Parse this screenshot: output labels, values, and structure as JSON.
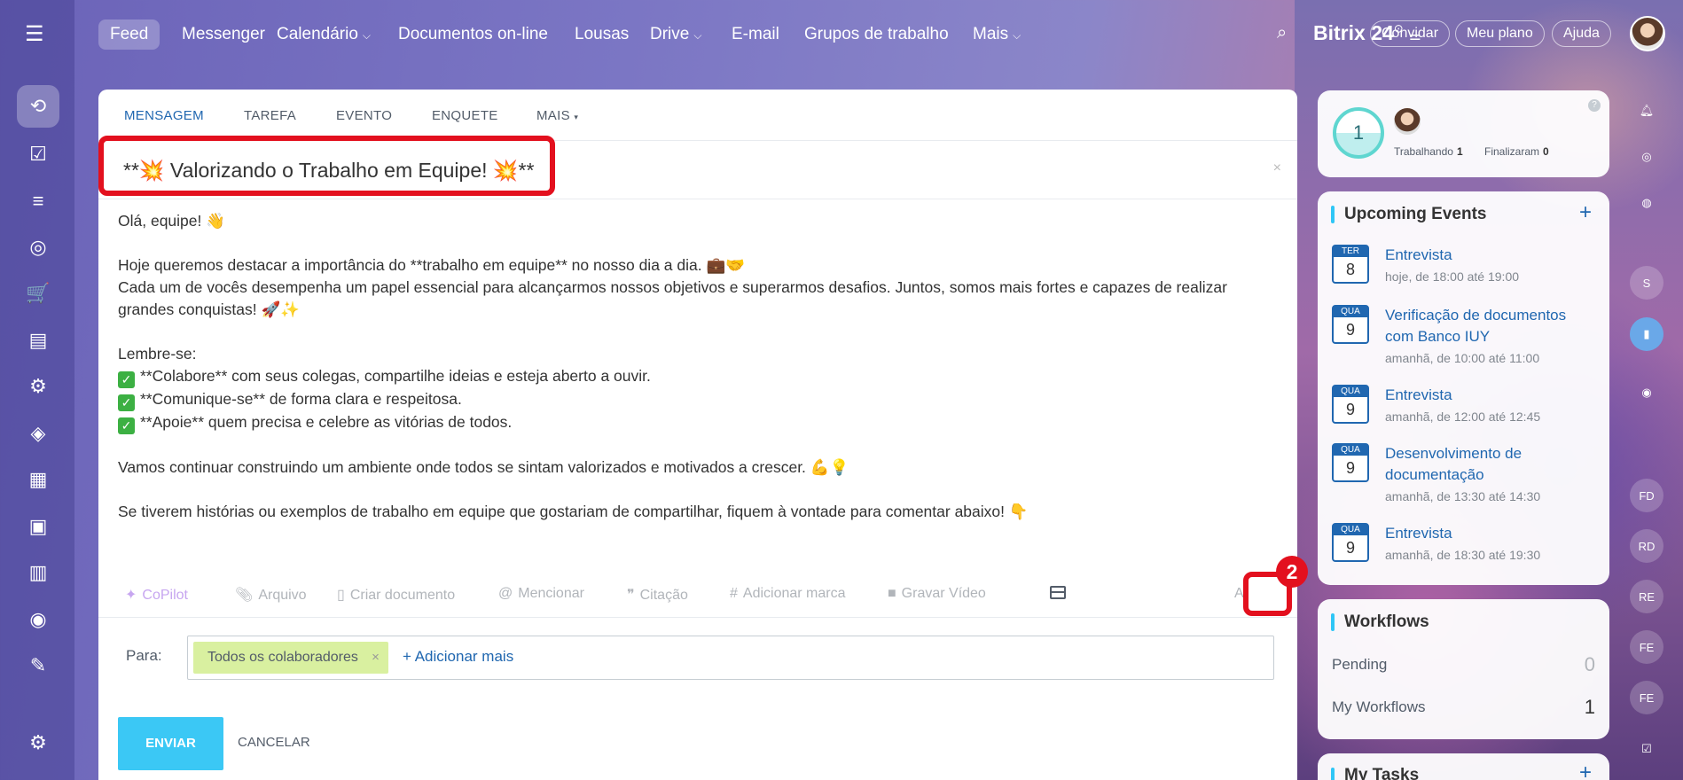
{
  "nav": {
    "items": [
      {
        "label": "Feed"
      },
      {
        "label": "Messenger"
      },
      {
        "label": "Calendário"
      },
      {
        "label": "Documentos on-line"
      },
      {
        "label": "Lousas"
      },
      {
        "label": "Drive"
      },
      {
        "label": "E-mail"
      },
      {
        "label": "Grupos de trabalho"
      },
      {
        "label": "Mais"
      }
    ],
    "brand": "Bitrix",
    "brand_suffix": "24",
    "buttons": {
      "invite": "Convidar",
      "plan": "Meu plano",
      "help": "Ajuda"
    }
  },
  "composer": {
    "tabs": [
      "MENSAGEM",
      "TAREFA",
      "EVENTO",
      "ENQUETE",
      "MAIS"
    ],
    "title": "**💥 Valorizando o Trabalho em Equipe! 💥**",
    "body": {
      "l1": "Olá, equipe! 👋",
      "l2": "Hoje queremos destacar a importância do **trabalho em equipe** no nosso dia a dia. 💼🤝",
      "l3": "Cada um de vocês desempenha um papel essencial para alcançarmos nossos objetivos e superarmos desafios. Juntos, somos mais fortes e capazes de realizar grandes conquistas! 🚀✨",
      "l4": "Lembre-se:",
      "l5": "**Colabore** com seus colegas, compartilhe ideias e esteja aberto a ouvir.",
      "l6": "**Comunique-se** de forma clara e respeitosa.",
      "l7": "**Apoie** quem precisa e celebre as vitórias de todos.",
      "l8": "Vamos continuar construindo um ambiente onde todos se sintam valorizados e motivados a crescer. 💪💡",
      "l9": "Se tiverem histórias ou exemplos de trabalho em equipe que gostariam de compartilhar, fiquem à vontade para comentar abaixo! 👇"
    },
    "toolbar": {
      "copilot": "CoPilot",
      "file": "Arquivo",
      "create_doc": "Criar documento",
      "mention": "Mencionar",
      "quote": "Citação",
      "tag": "Adicionar marca",
      "video": "Gravar Vídeo",
      "font": "A"
    },
    "badge": "2",
    "to_label": "Para:",
    "recipient": "Todos os colaboradores",
    "add_more": "+ Adicionar mais",
    "send": "ENVIAR",
    "cancel": "CANCELAR"
  },
  "status": {
    "count": "1",
    "working_label": "Trabalhando",
    "working_value": "1",
    "finished_label": "Finalizaram",
    "finished_value": "0",
    "help": "?"
  },
  "events": {
    "title": "Upcoming Events",
    "add": "+",
    "items": [
      {
        "dow": "TER",
        "day": "8",
        "name": "Entrevista",
        "time": "hoje, de 18:00 até 19:00"
      },
      {
        "dow": "QUA",
        "day": "9",
        "name": "Verificação de documentos com Banco IUY",
        "time": "amanhã, de 10:00 até 11:00"
      },
      {
        "dow": "QUA",
        "day": "9",
        "name": "Entrevista",
        "time": "amanhã, de 12:00 até 12:45"
      },
      {
        "dow": "QUA",
        "day": "9",
        "name": "Desenvolvimento de documentação",
        "time": "amanhã, de 13:30 até 14:30"
      },
      {
        "dow": "QUA",
        "day": "9",
        "name": "Entrevista",
        "time": "amanhã, de 18:30 até 19:30"
      }
    ]
  },
  "workflows": {
    "title": "Workflows",
    "pending_label": "Pending",
    "pending_value": "0",
    "mine_label": "My Workflows",
    "mine_value": "1"
  },
  "tasks": {
    "title": "My Tasks",
    "add": "+"
  },
  "right_rail": {
    "initials": [
      "S",
      "FD",
      "RD",
      "RE",
      "FE",
      "FE"
    ]
  },
  "colors": {
    "accent": "#2067b0",
    "send": "#3bc8f5",
    "highlight": "#e3101e",
    "chip": "#d9f0a0"
  }
}
